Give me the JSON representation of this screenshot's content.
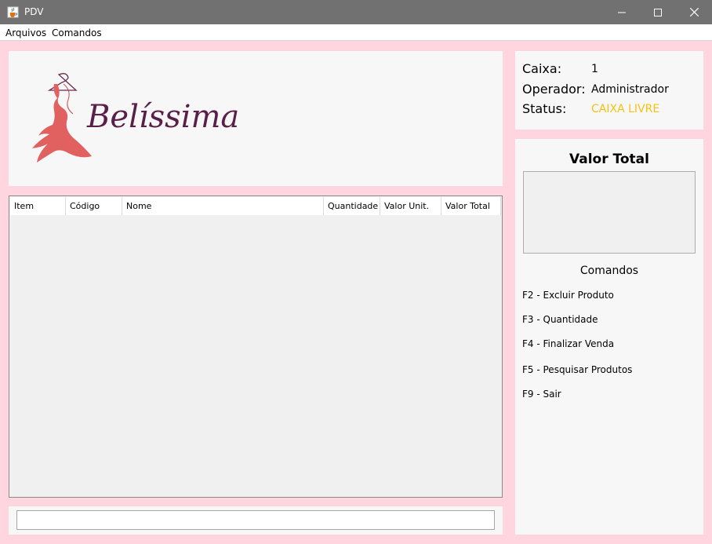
{
  "window": {
    "title": "PDV",
    "app_icon": "java-cup-icon"
  },
  "menu": {
    "items": [
      "Arquivos",
      "Comandos"
    ]
  },
  "logo": {
    "text": "Belíssima",
    "icon": "dress-on-hanger-icon",
    "colors": {
      "dress": "#e0615f",
      "text": "#5a1f48"
    }
  },
  "table": {
    "columns": [
      "Item",
      "Código",
      "Nome",
      "Quantidade",
      "Valor Unit.",
      "Valor Total"
    ],
    "rows": []
  },
  "search": {
    "value": ""
  },
  "info": {
    "caixa_label": "Caixa:",
    "caixa_value": "1",
    "operador_label": "Operador:",
    "operador_value": "Administrador",
    "status_label": "Status:",
    "status_value": "CAIXA LIVRE",
    "status_color": "#f5c211"
  },
  "total": {
    "label": "Valor Total",
    "value": ""
  },
  "commands": {
    "title": "Comandos",
    "items": [
      "F2 - Excluir Produto",
      "F3 - Quantidade",
      "F4 - Finalizar Venda",
      "F5 - Pesquisar Produtos",
      "F9 - Sair"
    ]
  },
  "colors": {
    "background": "#ffd6e0",
    "titlebar": "#717171",
    "panel": "#f7f7f7"
  }
}
